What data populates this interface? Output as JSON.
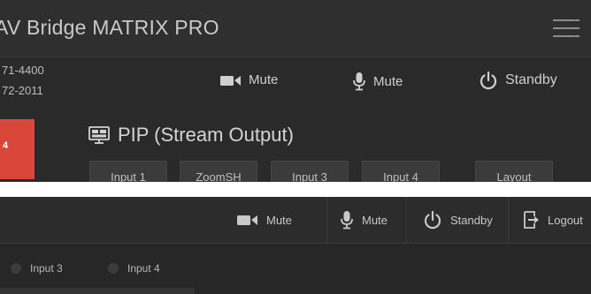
{
  "top_panel": {
    "app_title": "AV Bridge MATRIX PRO",
    "phone_lines": [
      "71-4400",
      "72-2011"
    ],
    "controls": {
      "camera_mute": "Mute",
      "mic_mute": "Mute",
      "standby": "Standby"
    },
    "red_tab_label": "4",
    "pip_title": "PIP (Stream Output)",
    "input_buttons": [
      "Input 1",
      "ZoomSH",
      "Input 3",
      "Input 4",
      "Layout"
    ]
  },
  "bottom_panel": {
    "controls": {
      "camera_mute": "Mute",
      "mic_mute": "Mute",
      "standby": "Standby",
      "logout": "Logout"
    },
    "inputs": [
      "Input 3",
      "Input 4"
    ]
  },
  "colors": {
    "background": "#2a2a2a",
    "accent_red": "#d9473b",
    "text": "#d6d6d6"
  }
}
